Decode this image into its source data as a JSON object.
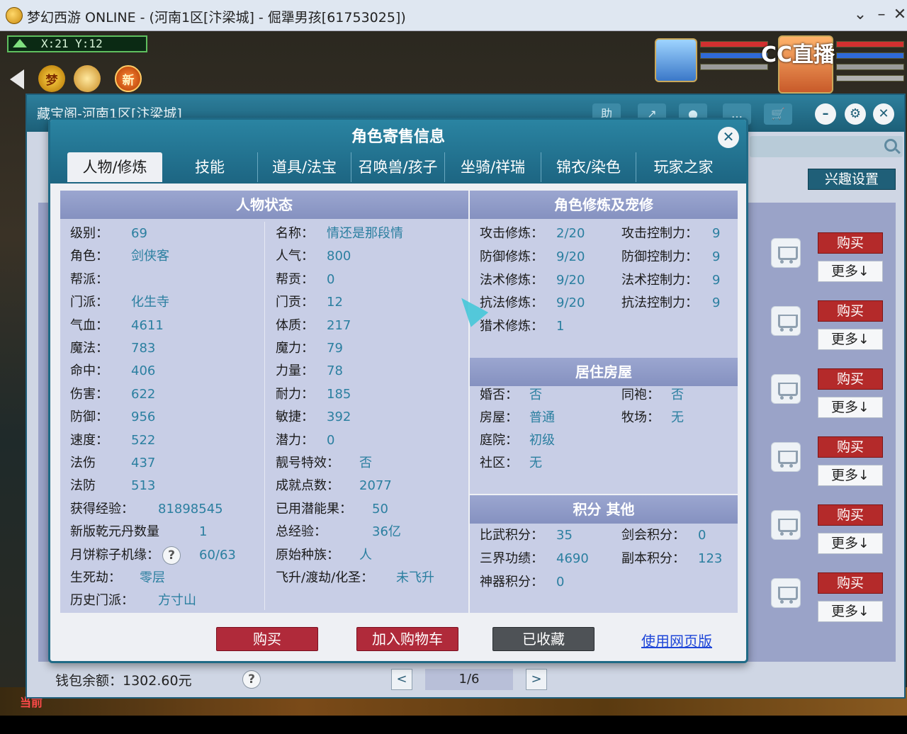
{
  "window": {
    "title": "梦幻西游 ONLINE - (河南1区[汴梁城] - 倔犟男孩[61753025])",
    "controls": [
      "⌄",
      "–",
      "✕"
    ]
  },
  "hud": {
    "coords": "X:21 Y:12",
    "icons": [
      "back-arrow-icon",
      "dream-icon",
      "gift-icon",
      "new-icon"
    ],
    "dream_label": "梦",
    "new_label": "新",
    "stream_logo": "CC直播",
    "bottom_channel": "当前"
  },
  "pavilion": {
    "title": "藏宝阁-河南1区[汴梁城]",
    "tools": [
      "助",
      "↗",
      "●",
      "…"
    ],
    "search_placeholder": "",
    "interest_button": "兴趣设置",
    "buy_label": "购买",
    "more_label": "更多↓",
    "wallet": "钱包余额：1302.60元",
    "help": "?",
    "page": "1/6",
    "prev": "<",
    "next": ">"
  },
  "modal": {
    "title": "角色寄售信息",
    "close": "✕",
    "tabs": [
      "人物/修炼",
      "技能",
      "道具/法宝",
      "召唤兽/孩子",
      "坐骑/祥瑞",
      "锦衣/染色",
      "玩家之家"
    ],
    "active_tab": 0,
    "status_title": "人物状态",
    "status_left": [
      {
        "k": "级别：",
        "v": "69"
      },
      {
        "k": "角色：",
        "v": "剑侠客"
      },
      {
        "k": "帮派：",
        "v": ""
      },
      {
        "k": "门派：",
        "v": "化生寺"
      },
      {
        "k": "气血：",
        "v": "4611"
      },
      {
        "k": "魔法：",
        "v": "783"
      },
      {
        "k": "命中：",
        "v": "406"
      },
      {
        "k": "伤害：",
        "v": "622"
      },
      {
        "k": "防御：",
        "v": "956"
      },
      {
        "k": "速度：",
        "v": "522"
      },
      {
        "k": "法伤",
        "v": "437"
      },
      {
        "k": "法防",
        "v": "513"
      },
      {
        "k": "获得经验：",
        "v": "81898545"
      },
      {
        "k": "新版乾元丹数量",
        "v": "1"
      },
      {
        "k": "月饼粽子机缘：",
        "v": "60/63"
      },
      {
        "k": "生死劫：",
        "v": "零层"
      },
      {
        "k": "历史门派：",
        "v": "方寸山"
      }
    ],
    "status_right": [
      {
        "k": "名称：",
        "v": "情还是那段情"
      },
      {
        "k": "人气：",
        "v": "800"
      },
      {
        "k": "帮贡：",
        "v": "0"
      },
      {
        "k": "门贡：",
        "v": "12"
      },
      {
        "k": "体质：",
        "v": "217"
      },
      {
        "k": "魔力：",
        "v": "79"
      },
      {
        "k": "力量：",
        "v": "78"
      },
      {
        "k": "耐力：",
        "v": "185"
      },
      {
        "k": "敏捷：",
        "v": "392"
      },
      {
        "k": "潜力：",
        "v": "0"
      },
      {
        "k": "靓号特效：",
        "v": "否"
      },
      {
        "k": "成就点数：",
        "v": "2077"
      },
      {
        "k": "已用潜能果：",
        "v": "50"
      },
      {
        "k": "总经验：",
        "v": "36亿"
      },
      {
        "k": "原始种族：",
        "v": "人"
      },
      {
        "k": "飞升/渡劫/化圣：",
        "v": "未飞升"
      }
    ],
    "cultivation_title": "角色修炼及宠修",
    "cultivation_left": [
      {
        "k": "攻击修炼：",
        "v": "2/20"
      },
      {
        "k": "防御修炼：",
        "v": "9/20"
      },
      {
        "k": "法术修炼：",
        "v": "9/20"
      },
      {
        "k": "抗法修炼：",
        "v": "9/20"
      },
      {
        "k": "猎术修炼：",
        "v": "1"
      }
    ],
    "cultivation_right": [
      {
        "k": "攻击控制力：",
        "v": "9"
      },
      {
        "k": "防御控制力：",
        "v": "9"
      },
      {
        "k": "法术控制力：",
        "v": "9"
      },
      {
        "k": "抗法控制力：",
        "v": "9"
      }
    ],
    "house_title": "居住房屋",
    "house": [
      {
        "k": "婚否：",
        "v": "否"
      },
      {
        "k": "同袍：",
        "v": "否"
      },
      {
        "k": "房屋：",
        "v": "普通"
      },
      {
        "k": "牧场：",
        "v": "无"
      },
      {
        "k": "庭院：",
        "v": "初级"
      },
      {
        "k": "社区：",
        "v": "无"
      }
    ],
    "points_title": "积分 其他",
    "points": [
      {
        "k": "比武积分：",
        "v": "35"
      },
      {
        "k": "剑会积分：",
        "v": "0"
      },
      {
        "k": "三界功绩：",
        "v": "4690"
      },
      {
        "k": "副本积分：",
        "v": "123"
      },
      {
        "k": "神器积分：",
        "v": "0"
      }
    ],
    "buttons": {
      "buy": "购买",
      "cart": "加入购物车",
      "fav": "已收藏"
    },
    "web_link": "使用网页版",
    "help": "?"
  }
}
